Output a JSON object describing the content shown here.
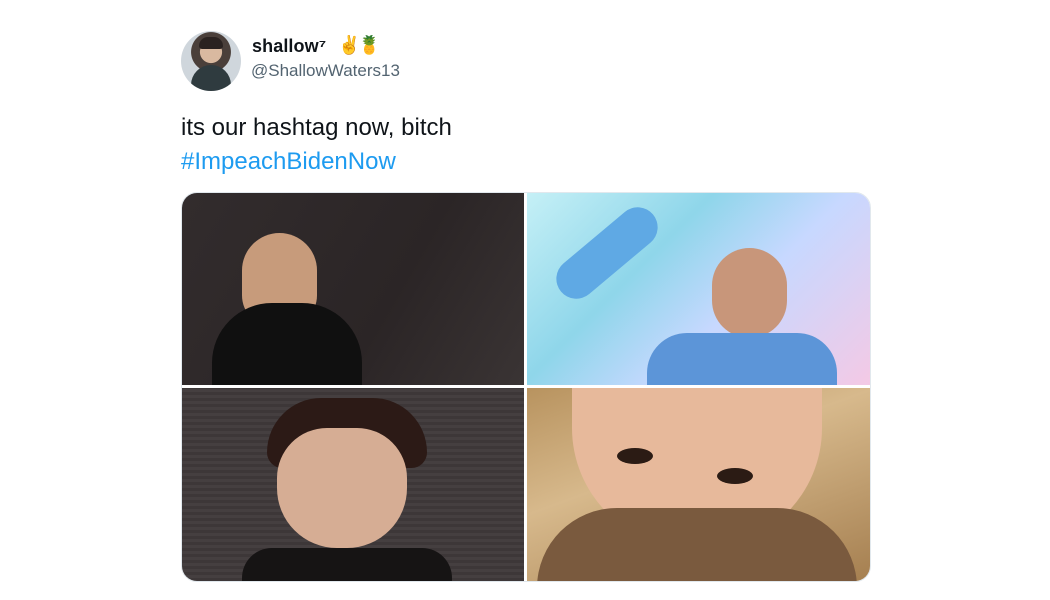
{
  "tweet": {
    "display_name": "shallow⁷",
    "name_emojis": [
      "✌️",
      "🍍"
    ],
    "handle": "@ShallowWaters13",
    "text": "its our hashtag now, bitch",
    "hashtag": "#ImpeachBidenNow"
  },
  "colors": {
    "hashtag": "#1d9bf0",
    "handle": "#536471",
    "text": "#0f1419"
  }
}
